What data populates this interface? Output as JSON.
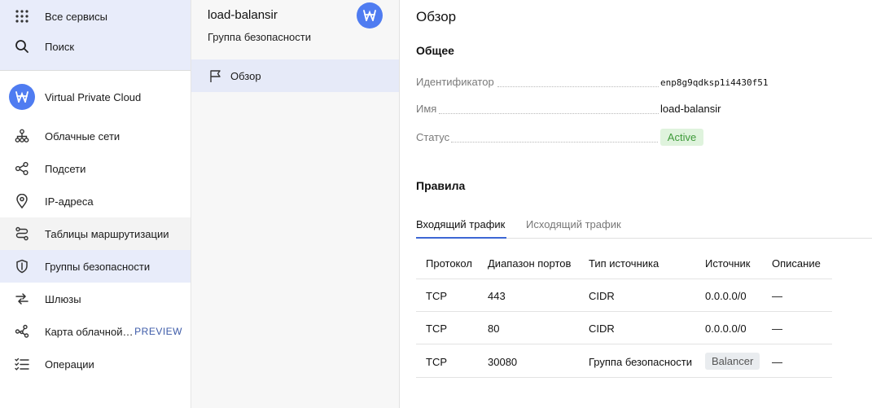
{
  "nav": {
    "all_services": "Все сервисы",
    "search": "Поиск",
    "vpc": "Virtual Private Cloud",
    "items": [
      {
        "label": "Облачные сети"
      },
      {
        "label": "Подсети"
      },
      {
        "label": "IP-адреса"
      },
      {
        "label": "Таблицы маршрутизации"
      },
      {
        "label": "Группы безопасности"
      },
      {
        "label": "Шлюзы"
      },
      {
        "label": "Карта облачной…",
        "badge": "PREVIEW"
      },
      {
        "label": "Операции"
      }
    ]
  },
  "resource": {
    "name": "load-balansir",
    "type": "Группа безопасности",
    "menu": [
      {
        "label": "Обзор"
      }
    ]
  },
  "main": {
    "title": "Обзор",
    "general": {
      "title": "Общее",
      "fields": [
        {
          "key": "Идентификатор",
          "value": "enp8g9qdksp1i4430f51"
        },
        {
          "key": "Имя",
          "value": "load-balansir"
        },
        {
          "key": "Статус",
          "value": "Active"
        }
      ]
    },
    "rules": {
      "title": "Правила",
      "tabs": [
        {
          "label": "Входящий трафик"
        },
        {
          "label": "Исходящий трафик"
        }
      ],
      "columns": [
        "Протокол",
        "Диапазон портов",
        "Тип источника",
        "Источник",
        "Описание"
      ],
      "rows": [
        {
          "protocol": "TCP",
          "ports": "443",
          "source_type": "CIDR",
          "source": "0.0.0.0/0",
          "description": "—"
        },
        {
          "protocol": "TCP",
          "ports": "80",
          "source_type": "CIDR",
          "source": "0.0.0.0/0",
          "description": "—"
        },
        {
          "protocol": "TCP",
          "ports": "30080",
          "source_type": "Группа безопасности",
          "source": "Balancer",
          "description": "—"
        }
      ]
    }
  },
  "colors": {
    "accent": "#4f7cf1",
    "active_status_bg": "#dff3dd",
    "active_status_text": "#3f9a3a"
  }
}
